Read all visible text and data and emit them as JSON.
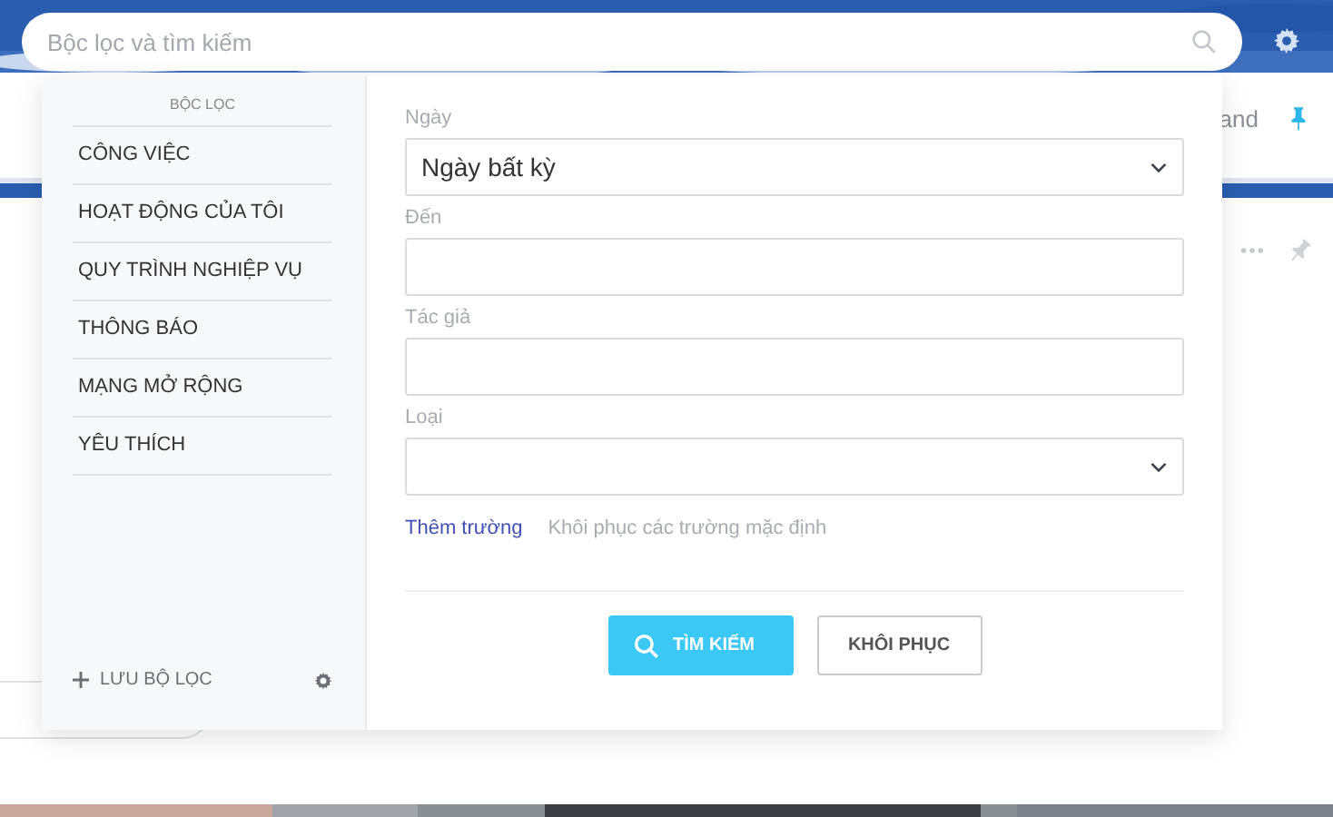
{
  "search": {
    "placeholder": "Bộc lọc và tìm kiếm"
  },
  "background": {
    "tab_text": "and"
  },
  "filter_panel": {
    "heading": "BỘC LỌC",
    "items": [
      {
        "label": "CÔNG VIỆC"
      },
      {
        "label": "HOẠT ĐỘNG CỦA TÔI"
      },
      {
        "label": "QUY TRÌNH NGHIỆP VỤ"
      },
      {
        "label": "THÔNG BÁO"
      },
      {
        "label": "MẠNG MỞ RỘNG"
      },
      {
        "label": "YÊU THÍCH"
      }
    ],
    "save_filter": "LƯU BỘ LỌC"
  },
  "fields": [
    {
      "label": "Ngày",
      "kind": "select",
      "value": "Ngày bất kỳ"
    },
    {
      "label": "Đến",
      "kind": "text"
    },
    {
      "label": "Tác giả",
      "kind": "text"
    },
    {
      "label": "Loại",
      "kind": "select"
    }
  ],
  "links": [
    {
      "label": "Thêm trường",
      "kind": "primary"
    },
    {
      "label": "Khôi phục các trường mặc định",
      "kind": "muted"
    }
  ],
  "buttons": [
    {
      "label": "TÌM KIẾM",
      "kind": "primary"
    },
    {
      "label": "KHÔI PHỤC",
      "kind": "outline"
    }
  ]
}
